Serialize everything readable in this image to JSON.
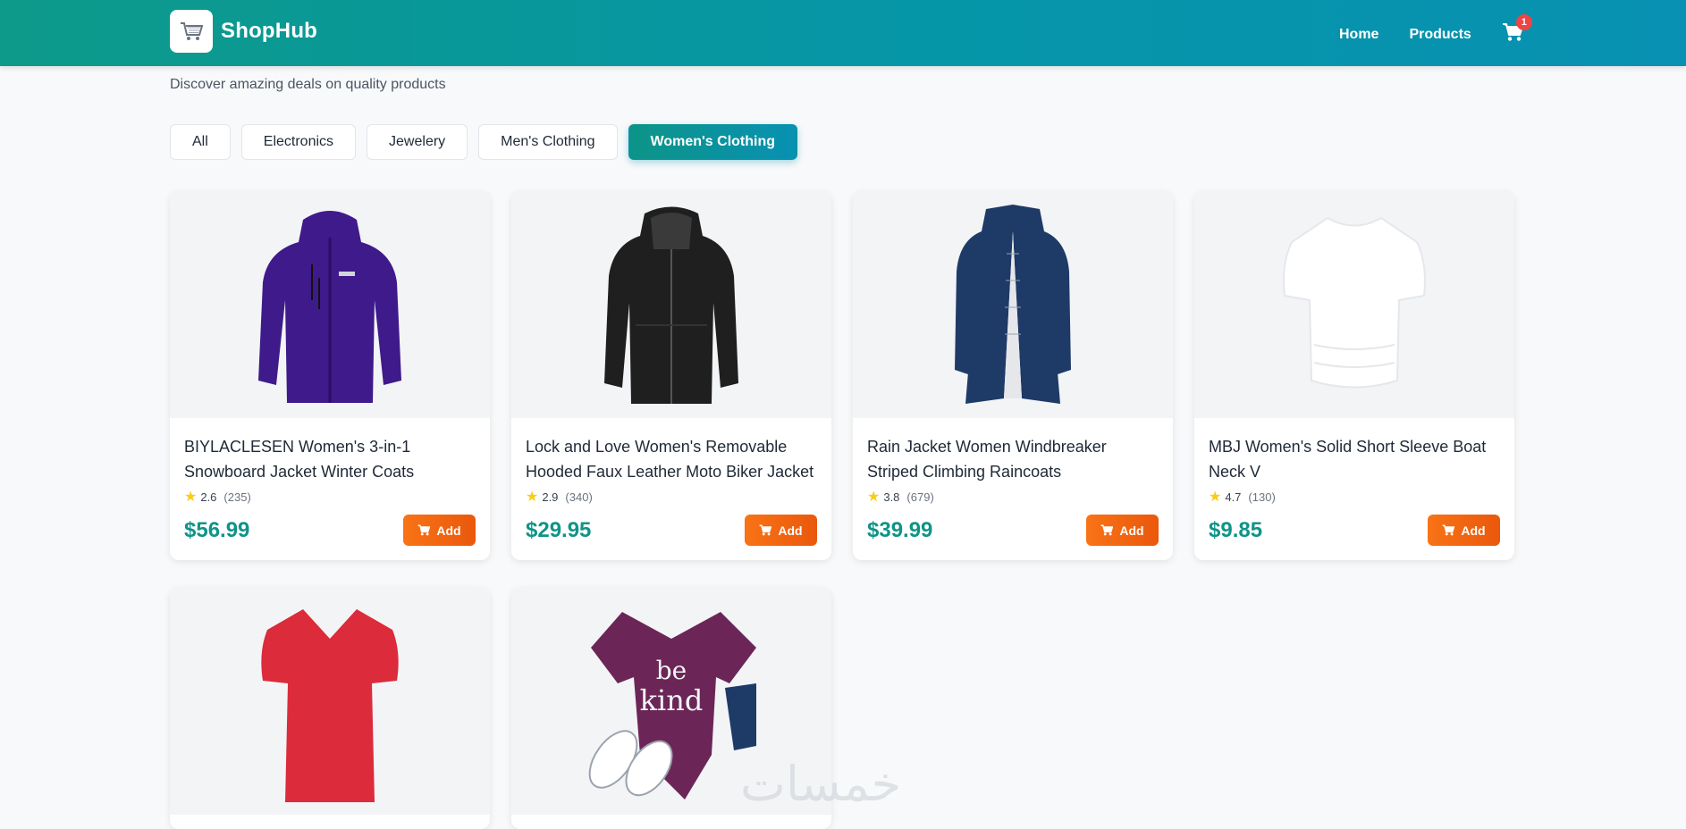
{
  "header": {
    "brand": "ShopHub",
    "nav": [
      "Home",
      "Products"
    ],
    "cart_count": "1"
  },
  "subtitle": "Discover amazing deals on quality products",
  "filters": [
    "All",
    "Electronics",
    "Jewelery",
    "Men's Clothing",
    "Women's Clothing"
  ],
  "active_filter": "Women's Clothing",
  "products": [
    {
      "title": "BIYLACLESEN Women's 3-in-1 Snowboard Jacket Winter Coats",
      "rating": "2.6",
      "count": "(235)",
      "price": "$56.99",
      "add_label": "Add"
    },
    {
      "title": "Lock and Love Women's Removable Hooded Faux Leather Moto Biker Jacket",
      "rating": "2.9",
      "count": "(340)",
      "price": "$29.95",
      "add_label": "Add"
    },
    {
      "title": "Rain Jacket Women Windbreaker Striped Climbing Raincoats",
      "rating": "3.8",
      "count": "(679)",
      "price": "$39.99",
      "add_label": "Add"
    },
    {
      "title": "MBJ Women's Solid Short Sleeve Boat Neck V",
      "rating": "4.7",
      "count": "(130)",
      "price": "$9.85",
      "add_label": "Add"
    }
  ],
  "watermark": "خمسات",
  "colors": {
    "primary": "#0d9488",
    "accent": "#f97316",
    "badge": "#ef4444"
  }
}
